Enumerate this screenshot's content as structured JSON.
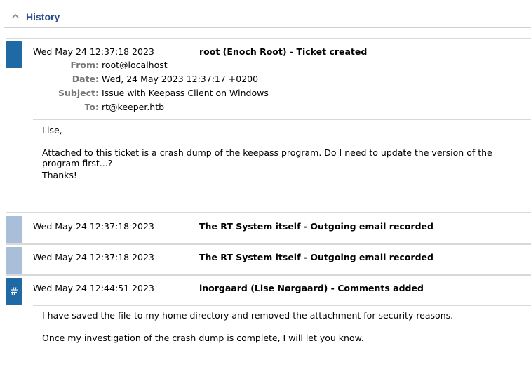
{
  "header": {
    "title": "History",
    "collapse_icon": "chevron-up-icon"
  },
  "colors": {
    "accent": "#1f6aa5",
    "muted": "#a9bfd9",
    "title": "#2c4f8c"
  },
  "transactions": [
    {
      "date": "Wed May 24 12:37:18 2023",
      "description": "root (Enoch Root) - Ticket created",
      "headers": [
        {
          "key": "From:",
          "value": "root@localhost"
        },
        {
          "key": "Date:",
          "value": "Wed, 24 May 2023 12:37:17 +0200"
        },
        {
          "key": "Subject:",
          "value": "Issue with Keepass Client on Windows"
        },
        {
          "key": "To:",
          "value": "rt@keeper.htb"
        }
      ],
      "body": [
        "Lise,",
        "Attached to this ticket is a crash dump of the keepass program. Do I need to update the version of the program first...?",
        "Thanks!"
      ]
    },
    {
      "date": "Wed May 24 12:37:18 2023",
      "description": "The RT System itself - Outgoing email recorded"
    },
    {
      "date": "Wed May 24 12:37:18 2023",
      "description": "The RT System itself - Outgoing email recorded"
    },
    {
      "date": "Wed May 24 12:44:51 2023",
      "description": "lnorgaard (Lise Nørgaard) - Comments added",
      "marker": "#",
      "body": [
        "I have saved the file to my home directory and removed the attachment for security reasons.",
        "Once my investigation of the crash dump is complete, I will let you know."
      ]
    }
  ]
}
